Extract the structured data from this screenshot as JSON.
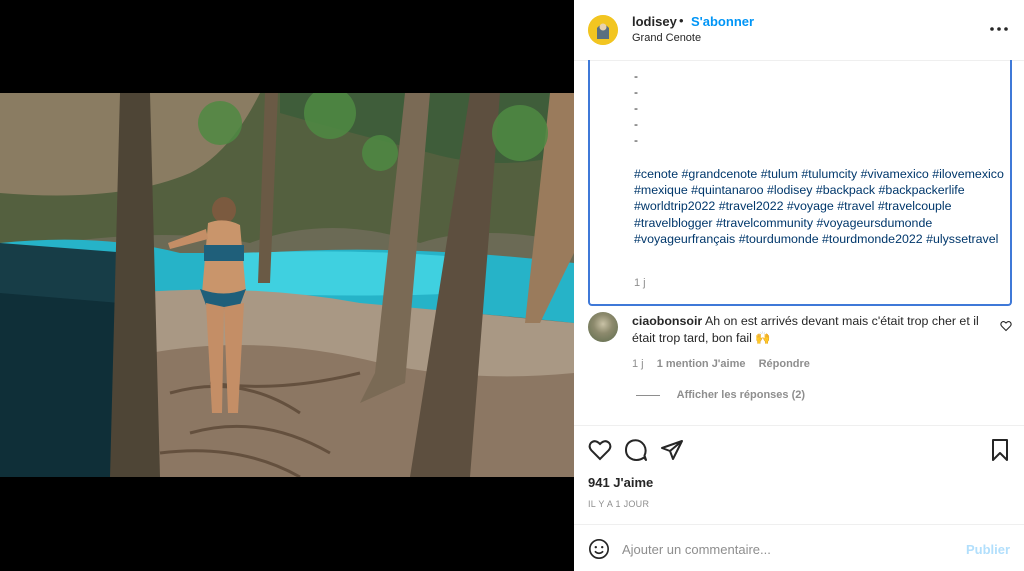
{
  "post": {
    "username": "lodisey",
    "separator": "•",
    "follow_label": "S'abonner",
    "location": "Grand Cenote",
    "more_icon": "more-options-icon"
  },
  "caption": {
    "dashes": [
      "-",
      "-",
      "-",
      "-",
      "-"
    ],
    "hashtags": "#cenote #grandcenote #tulum #tulumcity #vivamexico #ilovemexico #mexique #quintanaroo #lodisey #backpack #backpackerlife #worldtrip2022 #travel2022 #voyage #travel #travelcouple #travelblogger #travelcommunity #voyageursdumonde #voyageurfrançais #tourdumonde #tourdmonde2022 #ulyssetravel",
    "time": "1 j"
  },
  "comment": {
    "username": "ciaobonsoir",
    "text": "Ah on est arrivés devant mais c'était trop cher et il était trop tard, bon fail 🙌",
    "time": "1 j",
    "likes_label": "1 mention J'aime",
    "reply_label": "Répondre",
    "view_replies_label": "Afficher les réponses (2)"
  },
  "engagement": {
    "likes": "941 J'aime",
    "ago": "IL Y A 1 JOUR"
  },
  "composer": {
    "placeholder": "Ajouter un commentaire...",
    "publish_label": "Publier"
  },
  "colors": {
    "link_blue": "#0095f6",
    "hashtag_blue": "#00376b",
    "focus_border": "#3f79d8",
    "publish_disabled": "#b2dffc",
    "muted": "#8e8e8e"
  }
}
